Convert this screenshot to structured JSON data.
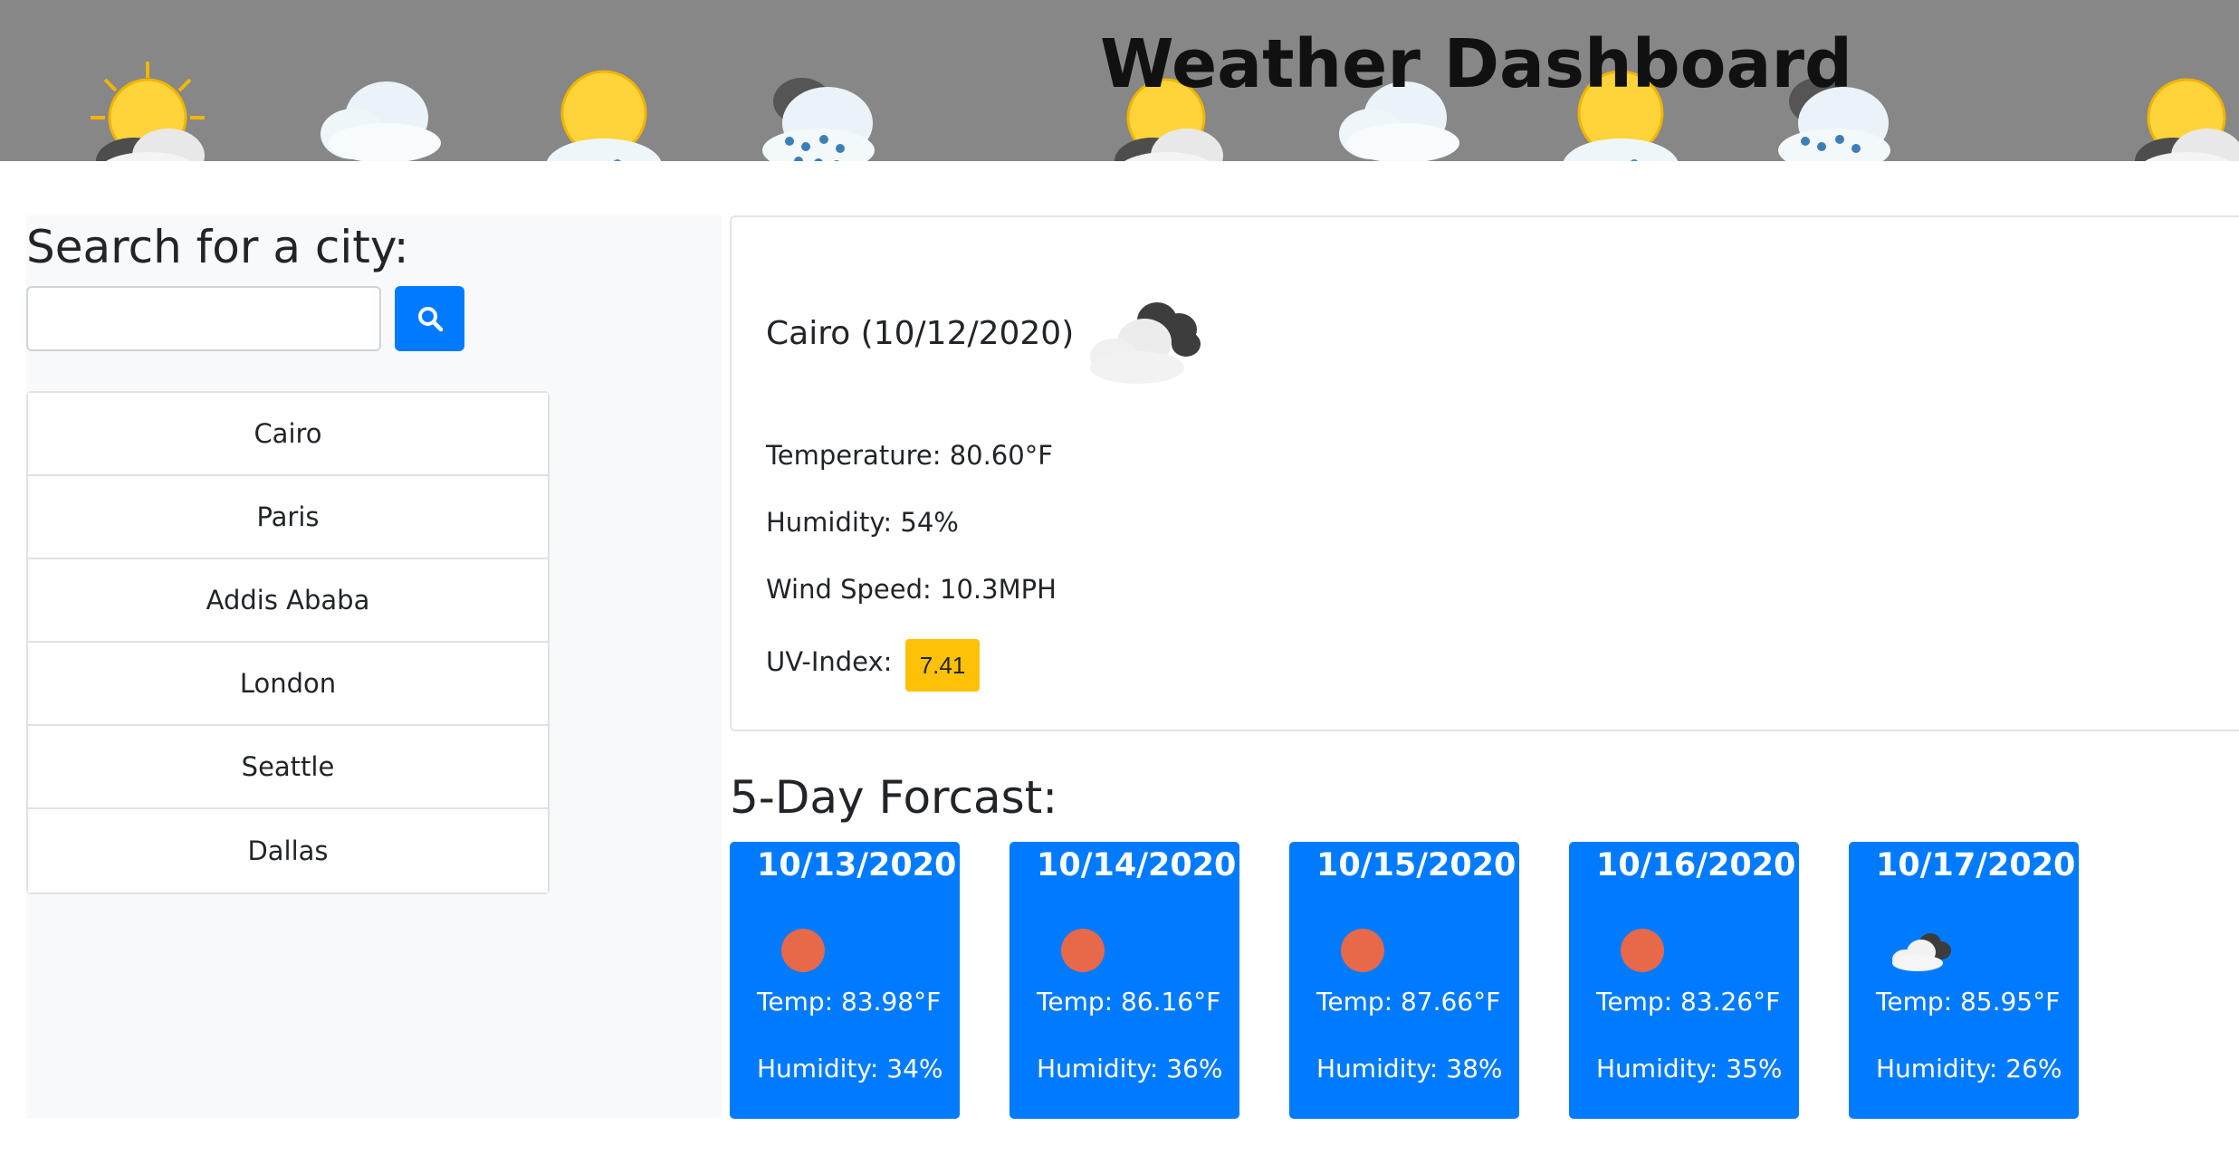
{
  "header": {
    "title": "Weather Dashboard",
    "banner_icons": [
      "partly-sunny-icon",
      "snow-cloud-icon",
      "sun-rain-icon",
      "rain-cloud-icon",
      "partly-sunny-icon",
      "snow-cloud-icon",
      "sun-rain-icon",
      "rain-cloud-icon",
      "partly-sunny-icon"
    ]
  },
  "search": {
    "title": "Search for a city:",
    "input_value": "",
    "button_icon": "search-icon"
  },
  "cities": [
    "Cairo",
    "Paris",
    "Addis Ababa",
    "London",
    "Seattle",
    "Dallas"
  ],
  "current": {
    "title": "Cairo (10/12/2020)",
    "icon": "broken-clouds-icon",
    "temperature": "Temperature: 80.60°F",
    "humidity": "Humidity: 54%",
    "wind": "Wind Speed: 10.3MPH",
    "uv_label": "UV-Index:",
    "uv_value": "7.41",
    "uv_color": "#ffc107"
  },
  "forecast": {
    "heading": "5-Day Forcast:",
    "card_color": "#007bff",
    "days": [
      {
        "date": "10/13/2020",
        "icon": "clear-sun-icon",
        "temp": "Temp: 83.98°F",
        "humidity": "Humidity: 34%"
      },
      {
        "date": "10/14/2020",
        "icon": "clear-sun-icon",
        "temp": "Temp: 86.16°F",
        "humidity": "Humidity: 36%"
      },
      {
        "date": "10/15/2020",
        "icon": "clear-sun-icon",
        "temp": "Temp: 87.66°F",
        "humidity": "Humidity: 38%"
      },
      {
        "date": "10/16/2020",
        "icon": "clear-sun-icon",
        "temp": "Temp: 83.26°F",
        "humidity": "Humidity: 35%"
      },
      {
        "date": "10/17/2020",
        "icon": "broken-clouds-icon",
        "temp": "Temp: 85.95°F",
        "humidity": "Humidity: 26%"
      }
    ]
  }
}
